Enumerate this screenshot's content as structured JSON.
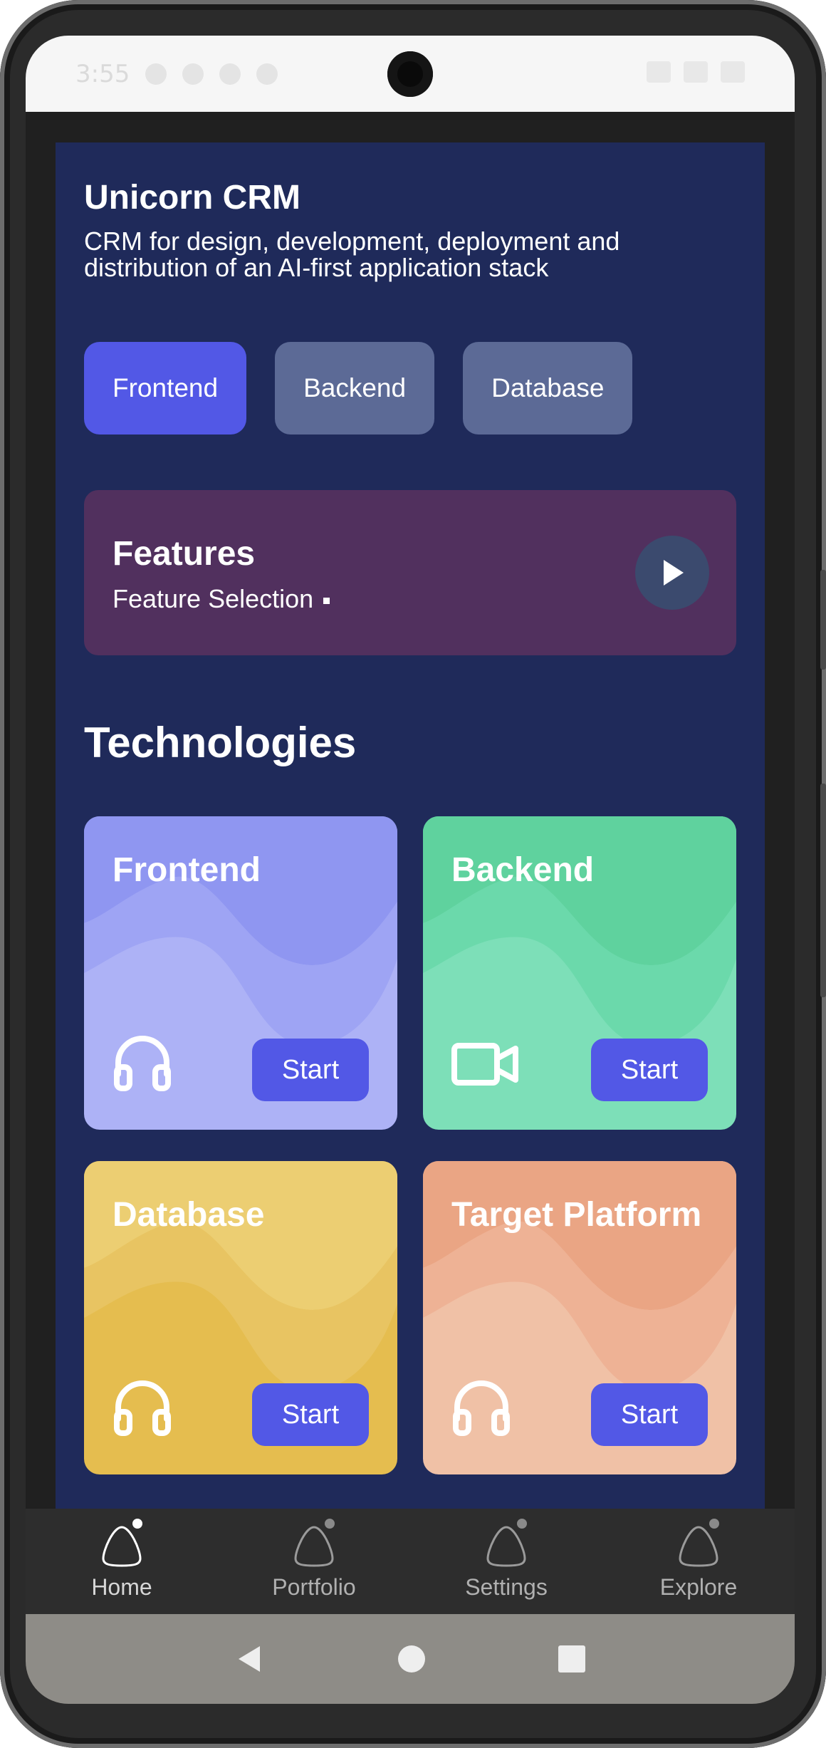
{
  "status": {
    "time": "3:55"
  },
  "app": {
    "title": "Unicorn CRM",
    "subtitle": "CRM for design, development, deployment and distribution of an AI-first application stack"
  },
  "tabs": [
    {
      "label": "Frontend",
      "active": true
    },
    {
      "label": "Backend",
      "active": false
    },
    {
      "label": "Database",
      "active": false
    }
  ],
  "features": {
    "title": "Features",
    "subtitle": "Feature Selection",
    "play_icon": "play-icon"
  },
  "section_title": "Technologies",
  "cards": [
    {
      "title": "Frontend",
      "icon": "headphones-icon",
      "button": "Start",
      "bg": "#adb2f6",
      "wave1": "#8f96f1",
      "wave2": "#9ea4f4"
    },
    {
      "title": "Backend",
      "icon": "video-camera-icon",
      "button": "Start",
      "bg": "#7ddfb8",
      "wave1": "#5fd29e",
      "wave2": "#6bd9ab"
    },
    {
      "title": "Database",
      "icon": "headphones-icon",
      "button": "Start",
      "bg": "#e5bd4f",
      "wave1": "#ecce72",
      "wave2": "#e8c462"
    },
    {
      "title": "Target Platform",
      "icon": "headphones-icon",
      "button": "Start",
      "bg": "#f0c1a6",
      "wave1": "#eaa584",
      "wave2": "#eeb295"
    }
  ],
  "bottom_nav": [
    {
      "label": "Home",
      "active": true
    },
    {
      "label": "Portfolio",
      "active": false
    },
    {
      "label": "Settings",
      "active": false
    },
    {
      "label": "Explore",
      "active": false
    }
  ],
  "colors": {
    "accent": "#5258e6",
    "background": "#1f2a5a",
    "features_bg": "#51305e"
  }
}
